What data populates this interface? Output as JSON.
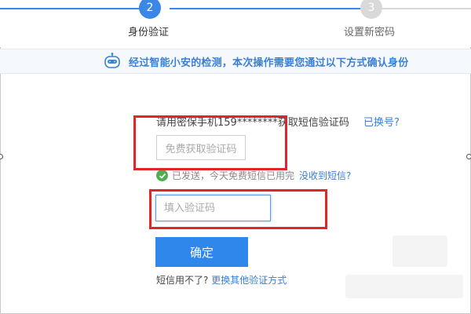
{
  "stepper": {
    "step1": {
      "number": "2",
      "label": "身份验证"
    },
    "step2": {
      "number": "3",
      "label": "设置新密码"
    },
    "colors": {
      "active": "#3b87e8",
      "inactive": "#d9d9d9"
    }
  },
  "notice": {
    "text": "经过智能小安的检测，本次操作需要您通过以下方式确认身份",
    "icon": "robot-icon"
  },
  "form": {
    "phone_prefix": "请用密保手机159********获取短信验证码",
    "changed_number_link": "已换号?",
    "get_code_button": "免费获取验证码",
    "sent_status": "已发送，今天免费短信已用完",
    "not_received_link": "没收到短信?",
    "code_input_placeholder": "填入验证码",
    "code_input_value": "",
    "confirm_button": "确定",
    "sms_unavailable": "短信用不了?",
    "other_methods_link": "更换其他验证方式"
  }
}
